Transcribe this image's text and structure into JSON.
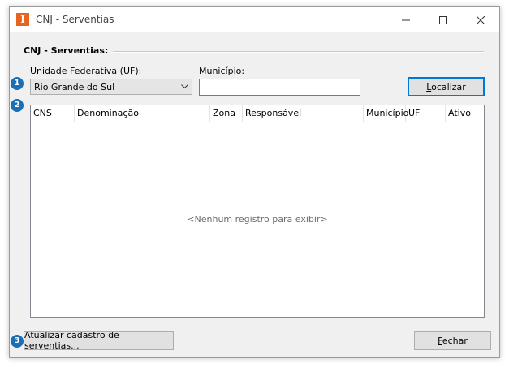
{
  "window": {
    "title": "CNJ - Serventias",
    "icon_glyph": "I",
    "icon_color": "#e8641e"
  },
  "group": {
    "title": "CNJ - Serventias:"
  },
  "filters": {
    "uf_label": "Unidade Federativa (UF):",
    "uf_selected": "Rio Grande do Sul",
    "municipio_label": "Município:",
    "municipio_value": ""
  },
  "buttons": {
    "localizar_prefix": "",
    "localizar_mnemonic": "L",
    "localizar_rest": "ocalizar",
    "atualizar": "Atualizar cadastro de serventias...",
    "fechar_mnemonic": "F",
    "fechar_rest": "echar"
  },
  "grid": {
    "columns": [
      "CNS",
      "Denominação",
      "Zona",
      "Responsável",
      "Município",
      "UF",
      "Ativo"
    ],
    "empty_message": "<Nenhum registro para exibir>"
  },
  "badges": [
    "1",
    "2",
    "3"
  ],
  "colors": {
    "badge": "#1a6fb5",
    "accent": "#0078d7"
  }
}
